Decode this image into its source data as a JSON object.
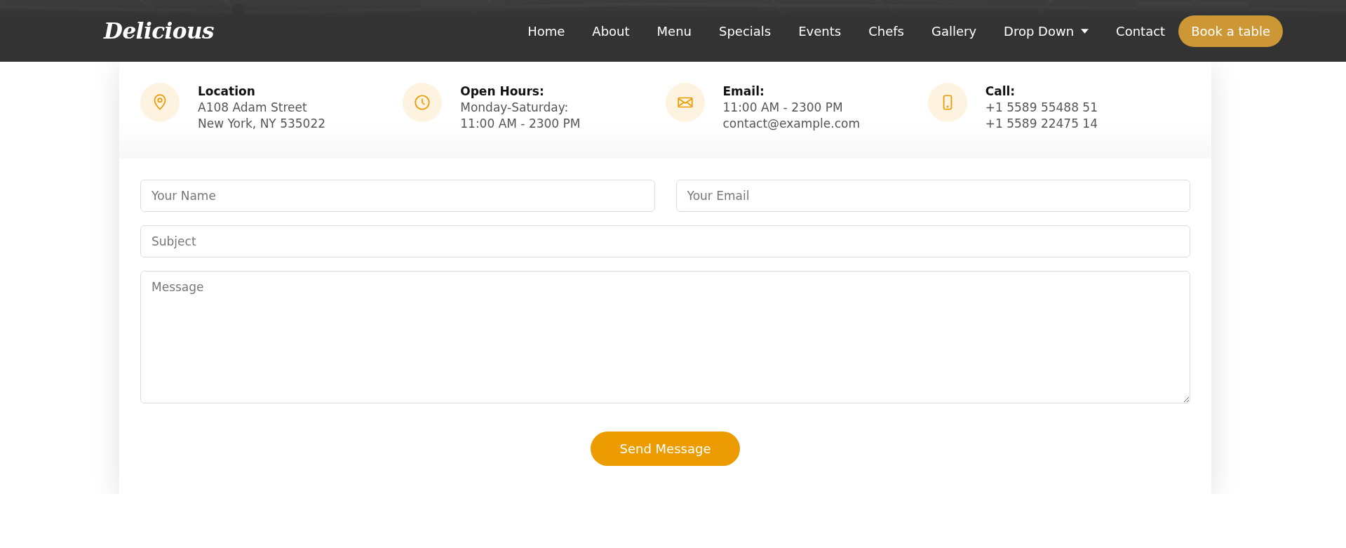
{
  "header": {
    "logo": "Delicious",
    "nav": [
      {
        "label": "Home",
        "kind": "link"
      },
      {
        "label": "About",
        "kind": "link"
      },
      {
        "label": "Menu",
        "kind": "link"
      },
      {
        "label": "Specials",
        "kind": "link"
      },
      {
        "label": "Events",
        "kind": "link"
      },
      {
        "label": "Chefs",
        "kind": "link"
      },
      {
        "label": "Gallery",
        "kind": "link"
      },
      {
        "label": "Drop Down",
        "kind": "dropdown"
      },
      {
        "label": "Contact",
        "kind": "link"
      }
    ],
    "cta": "Book a table"
  },
  "info": [
    {
      "kind": "location",
      "title": "Location",
      "lines": [
        "A108 Adam Street",
        "New York, NY 535022"
      ]
    },
    {
      "kind": "hours",
      "title": "Open Hours:",
      "lines": [
        "Monday-Saturday:",
        "11:00 AM - 2300 PM"
      ]
    },
    {
      "kind": "email",
      "title": "Email:",
      "lines": [
        "11:00 AM - 2300 PM",
        "contact@example.com"
      ]
    },
    {
      "kind": "phone",
      "title": "Call:",
      "lines": [
        "+1 5589 55488 51",
        "+1 5589 22475 14"
      ]
    }
  ],
  "form": {
    "name": {
      "placeholder": "Your Name"
    },
    "email": {
      "placeholder": "Your Email"
    },
    "subject": {
      "placeholder": "Subject"
    },
    "message": {
      "placeholder": "Message"
    },
    "submit": "Send Message"
  }
}
